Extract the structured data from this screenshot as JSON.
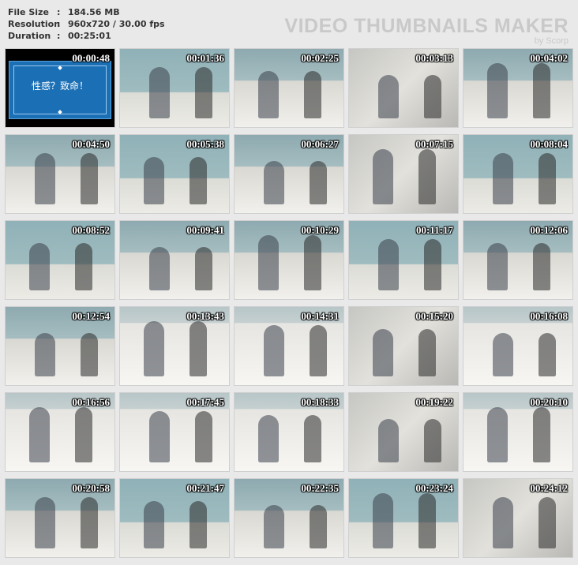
{
  "meta": [
    {
      "key": "File Size",
      "value": "184.56 MB"
    },
    {
      "key": "Resolution",
      "value": "960x720 / 30.00 fps"
    },
    {
      "key": "Duration",
      "value": "00:25:01"
    }
  ],
  "meta_separator": ":",
  "brand": {
    "title": "VIDEO THUMBNAILS MAKER",
    "by": "by Scorp"
  },
  "title_card_text": "性感？致命！",
  "thumbnails": [
    "00:00:48",
    "00:01:36",
    "00:02:25",
    "00:03:13",
    "00:04:02",
    "00:04:50",
    "00:05:38",
    "00:06:27",
    "00:07:15",
    "00:08:04",
    "00:08:52",
    "00:09:41",
    "00:10:29",
    "00:11:17",
    "00:12:06",
    "00:12:54",
    "00:13:43",
    "00:14:31",
    "00:15:20",
    "00:16:08",
    "00:16:56",
    "00:17:45",
    "00:18:33",
    "00:19:22",
    "00:20:10",
    "00:20:58",
    "00:21:47",
    "00:22:35",
    "00:23:24",
    "00:24:12"
  ]
}
